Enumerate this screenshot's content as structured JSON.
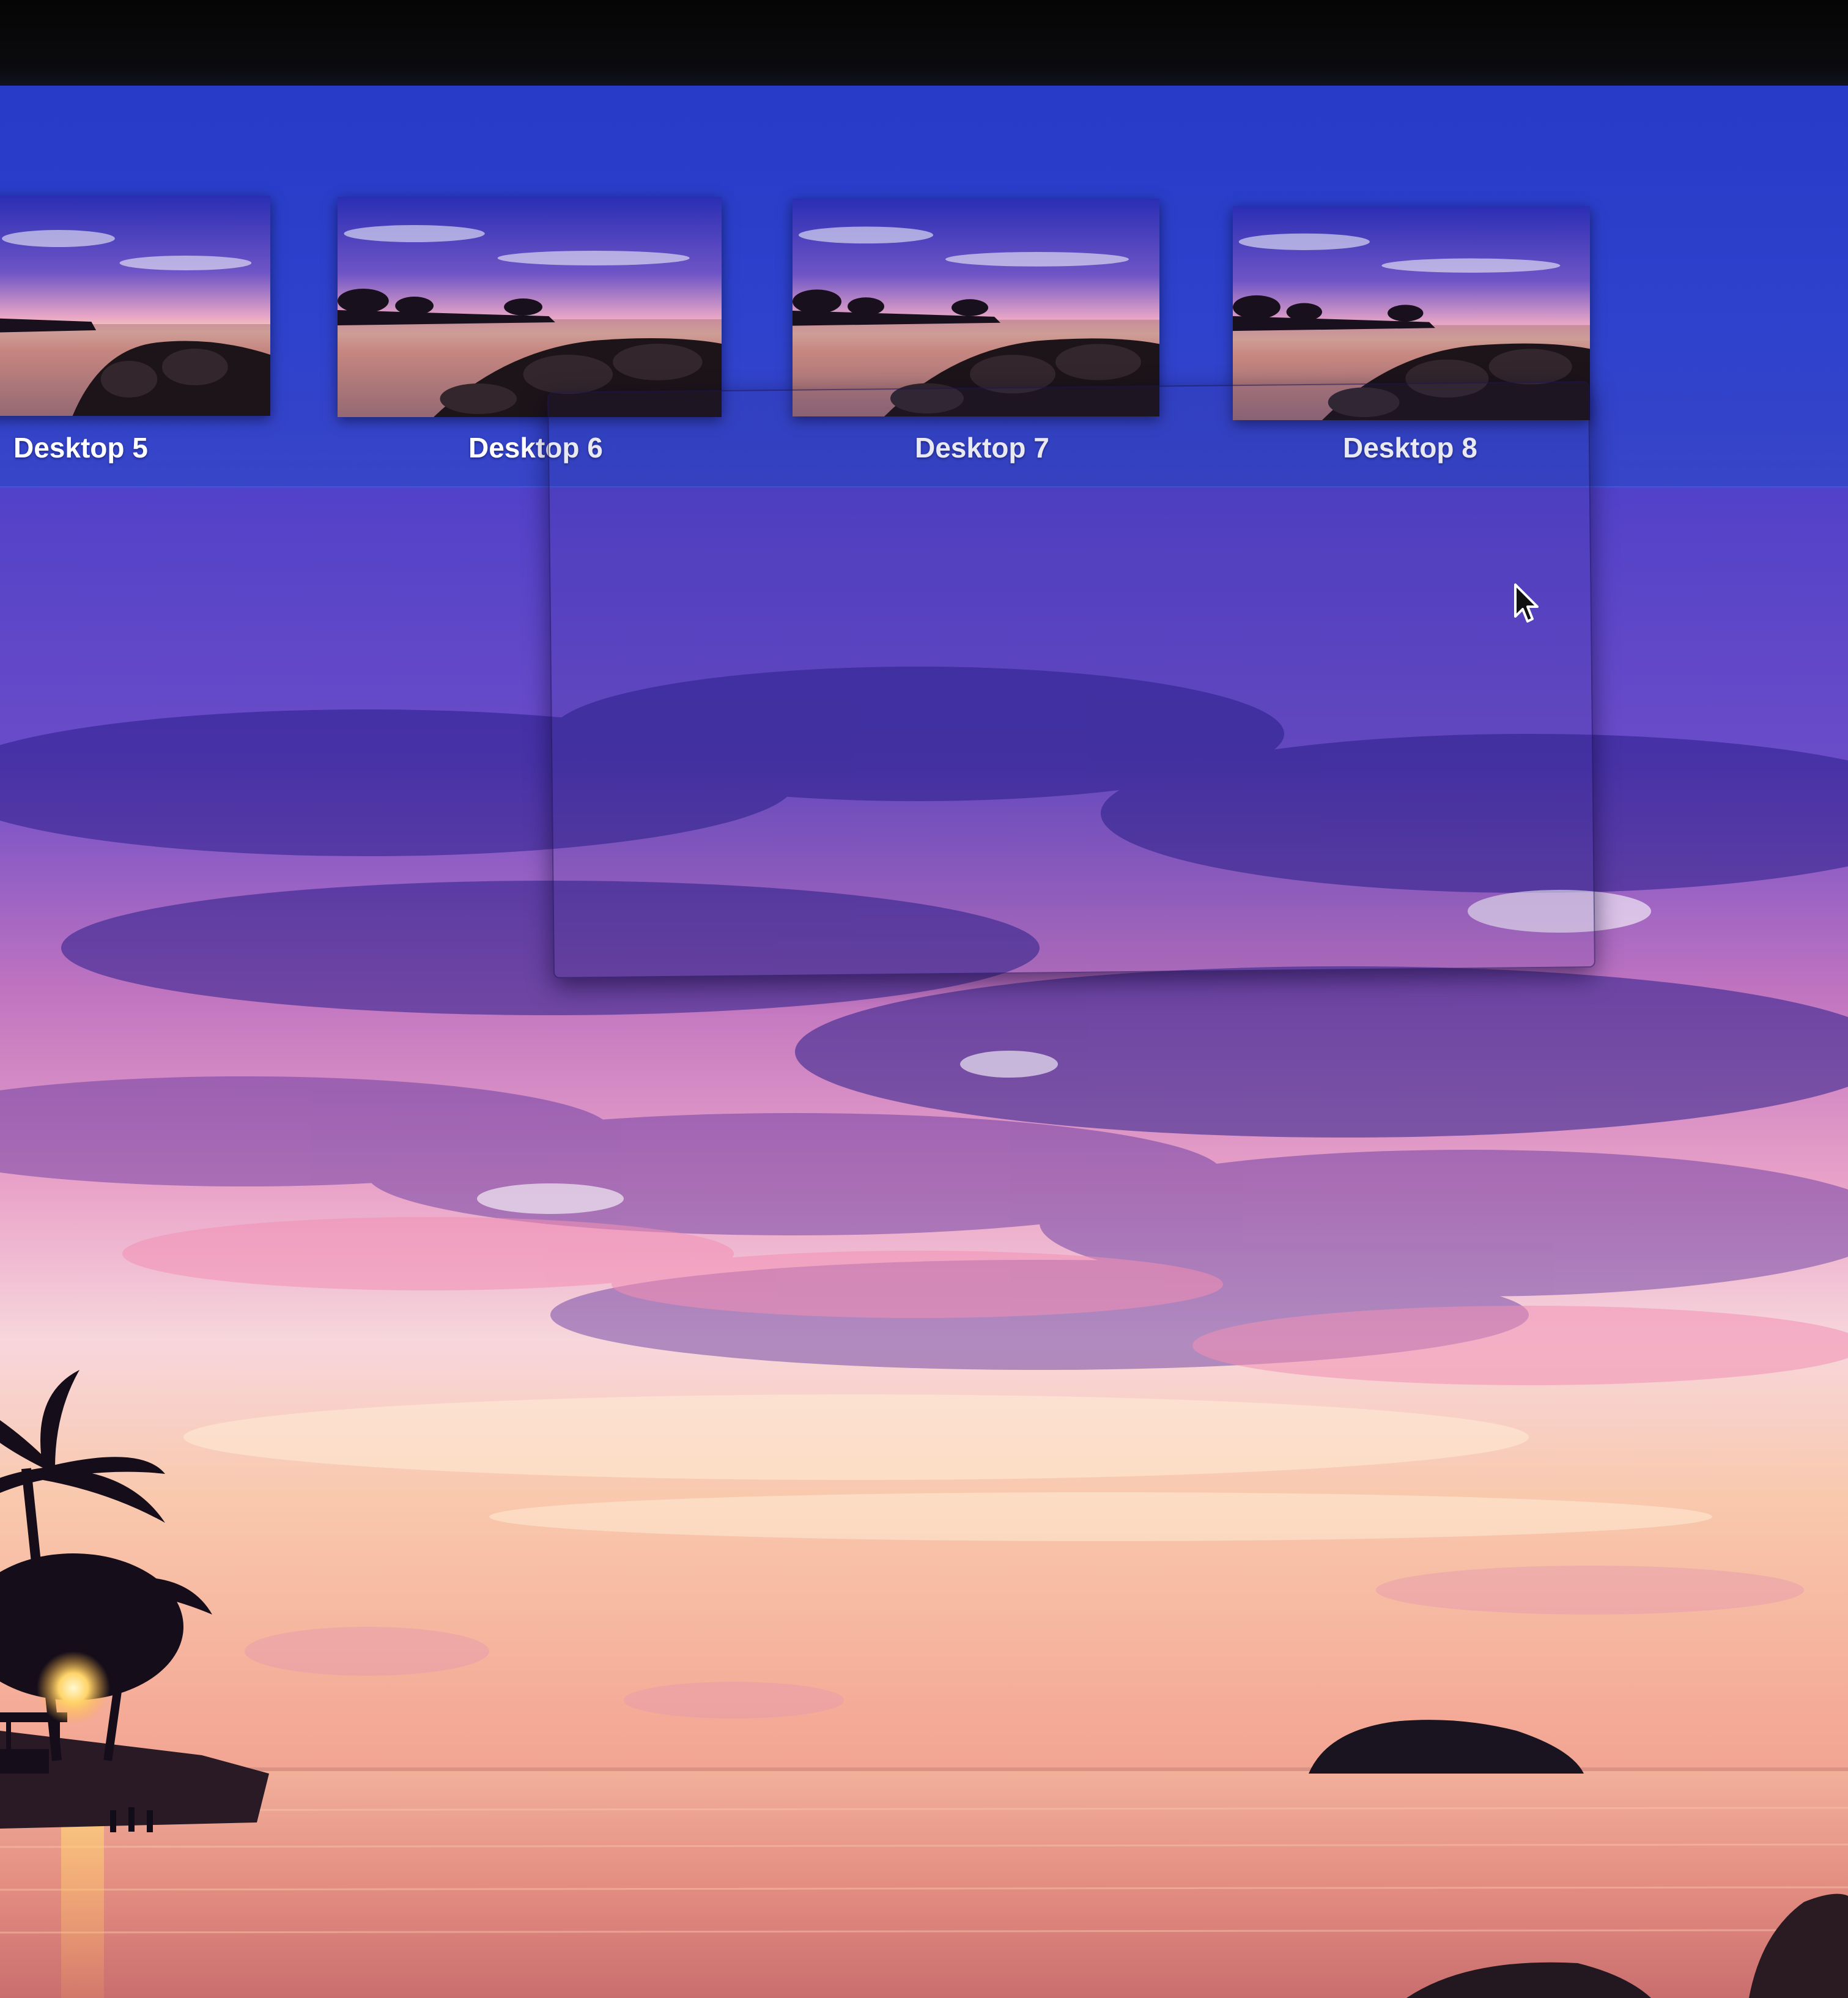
{
  "spaces": [
    {
      "label": "Desktop 5"
    },
    {
      "label": "Desktop 6"
    },
    {
      "label": "Desktop 7"
    },
    {
      "label": "Desktop 8"
    }
  ],
  "colors": {
    "spaces_bar": "#2b40c8",
    "label_text": "#ffffff",
    "sky_top": "#2c2fb0",
    "sky_mid": "#7b4fc8",
    "horizon": "#f6b7a2",
    "sea": "#e69a86"
  },
  "icons": {
    "cursor": "arrow-cursor-icon"
  }
}
